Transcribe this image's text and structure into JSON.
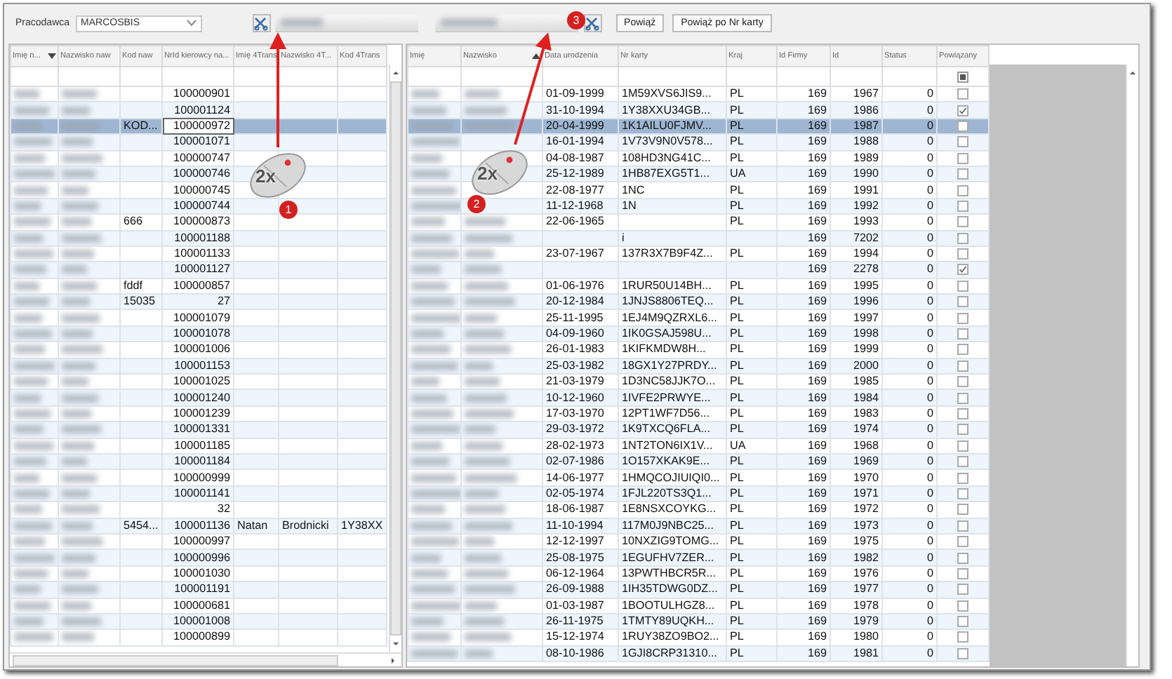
{
  "toolbar": {
    "employer_label": "Pracodawca",
    "employer_value": "MARCOSBIS",
    "buttons": [
      "Powiąż",
      "Powiąż po Nr karty"
    ]
  },
  "left_table": {
    "columns": [
      {
        "label": "Imię n...",
        "sort_ascending": false
      },
      {
        "label": "Nazwisko naw"
      },
      {
        "label": "Kod naw"
      },
      {
        "label": "NrId kierowcy na..."
      },
      {
        "label": "Imię 4Trans"
      },
      {
        "label": "Nazwisko 4T..."
      },
      {
        "label": "Kod 4Trans"
      }
    ],
    "rows": [
      {
        "cells": [
          "",
          "",
          "",
          "100000901",
          "",
          "",
          ""
        ],
        "selected": false
      },
      {
        "cells": [
          "",
          "",
          "",
          "100001124",
          "",
          "",
          ""
        ],
        "selected": false
      },
      {
        "cells": [
          "",
          "",
          "KOD...",
          "100000972",
          "",
          "",
          ""
        ],
        "selected": true
      },
      {
        "cells": [
          "",
          "",
          "",
          "100001071",
          "",
          "",
          ""
        ],
        "selected": false
      },
      {
        "cells": [
          "",
          "",
          "",
          "100000747",
          "",
          "",
          ""
        ],
        "selected": false
      },
      {
        "cells": [
          "",
          "",
          "",
          "100000746",
          "",
          "",
          ""
        ],
        "selected": false
      },
      {
        "cells": [
          "",
          "",
          "",
          "100000745",
          "",
          "",
          ""
        ],
        "selected": false
      },
      {
        "cells": [
          "",
          "",
          "",
          "100000744",
          "",
          "",
          ""
        ],
        "selected": false
      },
      {
        "cells": [
          "",
          "",
          "666",
          "100000873",
          "",
          "",
          ""
        ],
        "selected": false
      },
      {
        "cells": [
          "",
          "",
          "",
          "100001188",
          "",
          "",
          ""
        ],
        "selected": false
      },
      {
        "cells": [
          "",
          "",
          "",
          "100001133",
          "",
          "",
          ""
        ],
        "selected": false
      },
      {
        "cells": [
          "",
          "",
          "",
          "100001127",
          "",
          "",
          ""
        ],
        "selected": false
      },
      {
        "cells": [
          "",
          "",
          "fddf",
          "100000857",
          "",
          "",
          ""
        ],
        "selected": false
      },
      {
        "cells": [
          "",
          "",
          "15035",
          "27",
          "",
          "",
          ""
        ],
        "selected": false
      },
      {
        "cells": [
          "",
          "",
          "",
          "100001079",
          "",
          "",
          ""
        ],
        "selected": false
      },
      {
        "cells": [
          "",
          "",
          "",
          "100001078",
          "",
          "",
          ""
        ],
        "selected": false
      },
      {
        "cells": [
          "",
          "",
          "",
          "100001006",
          "",
          "",
          ""
        ],
        "selected": false
      },
      {
        "cells": [
          "",
          "",
          "",
          "100001153",
          "",
          "",
          ""
        ],
        "selected": false
      },
      {
        "cells": [
          "",
          "",
          "",
          "100001025",
          "",
          "",
          ""
        ],
        "selected": false
      },
      {
        "cells": [
          "",
          "",
          "",
          "100001240",
          "",
          "",
          ""
        ],
        "selected": false
      },
      {
        "cells": [
          "",
          "",
          "",
          "100001239",
          "",
          "",
          ""
        ],
        "selected": false
      },
      {
        "cells": [
          "",
          "",
          "",
          "100001331",
          "",
          "",
          ""
        ],
        "selected": false
      },
      {
        "cells": [
          "",
          "",
          "",
          "100001185",
          "",
          "",
          ""
        ],
        "selected": false
      },
      {
        "cells": [
          "",
          "",
          "",
          "100001184",
          "",
          "",
          ""
        ],
        "selected": false
      },
      {
        "cells": [
          "",
          "",
          "",
          "100000999",
          "",
          "",
          ""
        ],
        "selected": false
      },
      {
        "cells": [
          "",
          "",
          "",
          "100001141",
          "",
          "",
          ""
        ],
        "selected": false
      },
      {
        "cells": [
          "",
          "",
          "",
          "32",
          "",
          "",
          ""
        ],
        "selected": false
      },
      {
        "cells": [
          "",
          "",
          "5454...",
          "100001136",
          "Natan",
          "Brodnicki",
          "1Y38XX"
        ],
        "selected": false
      },
      {
        "cells": [
          "",
          "",
          "",
          "100000997",
          "",
          "",
          ""
        ],
        "selected": false
      },
      {
        "cells": [
          "",
          "",
          "",
          "100000996",
          "",
          "",
          ""
        ],
        "selected": false
      },
      {
        "cells": [
          "",
          "",
          "",
          "100001030",
          "",
          "",
          ""
        ],
        "selected": false
      },
      {
        "cells": [
          "",
          "",
          "",
          "100001191",
          "",
          "",
          ""
        ],
        "selected": false
      },
      {
        "cells": [
          "",
          "",
          "",
          "100000681",
          "",
          "",
          ""
        ],
        "selected": false
      },
      {
        "cells": [
          "",
          "",
          "",
          "100001008",
          "",
          "",
          ""
        ],
        "selected": false
      },
      {
        "cells": [
          "",
          "",
          "",
          "100000899",
          "",
          "",
          ""
        ],
        "selected": false
      }
    ]
  },
  "right_table": {
    "columns": [
      {
        "label": "Imię"
      },
      {
        "label": "Nazwisko",
        "sort_ascending": true
      },
      {
        "label": "Data urodzenia"
      },
      {
        "label": "Nr karty"
      },
      {
        "label": "Kraj"
      },
      {
        "label": "Id Firmy"
      },
      {
        "label": "Id"
      },
      {
        "label": "Status"
      },
      {
        "label": "Powiązany"
      }
    ],
    "header_checkbox_indeterminate": true,
    "rows": [
      {
        "cells": [
          "",
          "",
          "01-09-1999",
          "1M59XVS6JIS9...",
          "PL",
          "169",
          "1967",
          "0"
        ],
        "checked": false,
        "selected": false
      },
      {
        "cells": [
          "",
          "",
          "31-10-1994",
          "1Y38XXU34GB...",
          "PL",
          "169",
          "1986",
          "0"
        ],
        "checked": true,
        "selected": false
      },
      {
        "cells": [
          "",
          "",
          "20-04-1999",
          "1K1AILU0FJMV...",
          "PL",
          "169",
          "1987",
          "0"
        ],
        "checked": false,
        "selected": true
      },
      {
        "cells": [
          "",
          "",
          "16-01-1994",
          "1V73V9N0V578...",
          "PL",
          "169",
          "1988",
          "0"
        ],
        "checked": false,
        "selected": false
      },
      {
        "cells": [
          "",
          "",
          "04-08-1987",
          "108HD3NG41C...",
          "PL",
          "169",
          "1989",
          "0"
        ],
        "checked": false,
        "selected": false
      },
      {
        "cells": [
          "",
          "",
          "25-12-1989",
          "1HB87EXG5T1...",
          "UA",
          "169",
          "1990",
          "0"
        ],
        "checked": false,
        "selected": false
      },
      {
        "cells": [
          "",
          "",
          "22-08-1977",
          "1NC",
          "PL",
          "169",
          "1991",
          "0"
        ],
        "checked": false,
        "selected": false
      },
      {
        "cells": [
          "",
          "",
          "11-12-1968",
          "1N",
          "PL",
          "169",
          "1992",
          "0"
        ],
        "checked": false,
        "selected": false
      },
      {
        "cells": [
          "",
          "",
          "22-06-1965",
          "",
          "PL",
          "169",
          "1993",
          "0"
        ],
        "checked": false,
        "selected": false
      },
      {
        "cells": [
          "",
          "",
          "",
          "i",
          "",
          "169",
          "7202",
          "0"
        ],
        "checked": false,
        "selected": false
      },
      {
        "cells": [
          "",
          "",
          "23-07-1967",
          "137R3X7B9F4Z...",
          "PL",
          "169",
          "1994",
          "0"
        ],
        "checked": false,
        "selected": false
      },
      {
        "cells": [
          "",
          "",
          "",
          "",
          "",
          "169",
          "2278",
          "0"
        ],
        "checked": true,
        "selected": false
      },
      {
        "cells": [
          "",
          "",
          "01-06-1976",
          "1RUR50U14BH...",
          "PL",
          "169",
          "1995",
          "0"
        ],
        "checked": false,
        "selected": false
      },
      {
        "cells": [
          "",
          "",
          "20-12-1984",
          "1JNJS8806TEQ...",
          "PL",
          "169",
          "1996",
          "0"
        ],
        "checked": false,
        "selected": false
      },
      {
        "cells": [
          "",
          "",
          "25-11-1995",
          "1EJ4M9QZRXL6...",
          "PL",
          "169",
          "1997",
          "0"
        ],
        "checked": false,
        "selected": false
      },
      {
        "cells": [
          "",
          "",
          "04-09-1960",
          "1IK0GSAJ598U...",
          "PL",
          "169",
          "1998",
          "0"
        ],
        "checked": false,
        "selected": false
      },
      {
        "cells": [
          "",
          "",
          "26-01-1983",
          "1KIFKMDW8H...",
          "PL",
          "169",
          "1999",
          "0"
        ],
        "checked": false,
        "selected": false
      },
      {
        "cells": [
          "",
          "",
          "25-03-1982",
          "18GX1Y27PRDY...",
          "PL",
          "169",
          "2000",
          "0"
        ],
        "checked": false,
        "selected": false
      },
      {
        "cells": [
          "",
          "",
          "21-03-1979",
          "1D3NC58JJK7O...",
          "PL",
          "169",
          "1985",
          "0"
        ],
        "checked": false,
        "selected": false
      },
      {
        "cells": [
          "",
          "",
          "10-12-1960",
          "1IVFE2PRWYE...",
          "PL",
          "169",
          "1984",
          "0"
        ],
        "checked": false,
        "selected": false
      },
      {
        "cells": [
          "",
          "",
          "17-03-1970",
          "12PT1WF7D56...",
          "PL",
          "169",
          "1983",
          "0"
        ],
        "checked": false,
        "selected": false
      },
      {
        "cells": [
          "",
          "",
          "29-03-1972",
          "1K9TXCQ6FLA...",
          "PL",
          "169",
          "1974",
          "0"
        ],
        "checked": false,
        "selected": false
      },
      {
        "cells": [
          "",
          "",
          "28-02-1973",
          "1NT2TON6IX1V...",
          "UA",
          "169",
          "1968",
          "0"
        ],
        "checked": false,
        "selected": false
      },
      {
        "cells": [
          "",
          "",
          "02-07-1986",
          "1O157XKAK9E...",
          "PL",
          "169",
          "1969",
          "0"
        ],
        "checked": false,
        "selected": false
      },
      {
        "cells": [
          "",
          "",
          "14-06-1977",
          "1HMQCOJIUIQI0...",
          "PL",
          "169",
          "1970",
          "0"
        ],
        "checked": false,
        "selected": false
      },
      {
        "cells": [
          "",
          "",
          "02-05-1974",
          "1FJL220TS3Q1...",
          "PL",
          "169",
          "1971",
          "0"
        ],
        "checked": false,
        "selected": false
      },
      {
        "cells": [
          "",
          "",
          "18-06-1987",
          "1E8NSXCOYKG...",
          "PL",
          "169",
          "1972",
          "0"
        ],
        "checked": false,
        "selected": false
      },
      {
        "cells": [
          "",
          "",
          "11-10-1994",
          "117M0J9NBC25...",
          "PL",
          "169",
          "1973",
          "0"
        ],
        "checked": false,
        "selected": false
      },
      {
        "cells": [
          "",
          "",
          "12-12-1997",
          "10NXZIG9TOMG...",
          "PL",
          "169",
          "1975",
          "0"
        ],
        "checked": false,
        "selected": false
      },
      {
        "cells": [
          "",
          "",
          "25-08-1975",
          "1EGUFHV7ZER...",
          "PL",
          "169",
          "1982",
          "0"
        ],
        "checked": false,
        "selected": false
      },
      {
        "cells": [
          "",
          "",
          "06-12-1964",
          "13PWTHBCR5R...",
          "PL",
          "169",
          "1976",
          "0"
        ],
        "checked": false,
        "selected": false
      },
      {
        "cells": [
          "",
          "",
          "26-09-1988",
          "1IH35TDWG0DZ...",
          "PL",
          "169",
          "1977",
          "0"
        ],
        "checked": false,
        "selected": false
      },
      {
        "cells": [
          "",
          "",
          "01-03-1987",
          "1BOOTULHGZ8...",
          "PL",
          "169",
          "1978",
          "0"
        ],
        "checked": false,
        "selected": false
      },
      {
        "cells": [
          "",
          "",
          "26-11-1975",
          "1TMTY89UQKH...",
          "PL",
          "169",
          "1979",
          "0"
        ],
        "checked": false,
        "selected": false
      },
      {
        "cells": [
          "",
          "",
          "15-12-1974",
          "1RUY38ZO9BO2...",
          "PL",
          "169",
          "1980",
          "0"
        ],
        "checked": false,
        "selected": false
      },
      {
        "cells": [
          "",
          "",
          "08-10-1986",
          "1GJI8CRP31310...",
          "PL",
          "169",
          "1981",
          "0"
        ],
        "checked": false,
        "selected": false
      }
    ]
  },
  "annotations": [
    {
      "badge": "1",
      "label": "2x"
    },
    {
      "badge": "2",
      "label": "2x"
    },
    {
      "badge": "3"
    }
  ]
}
